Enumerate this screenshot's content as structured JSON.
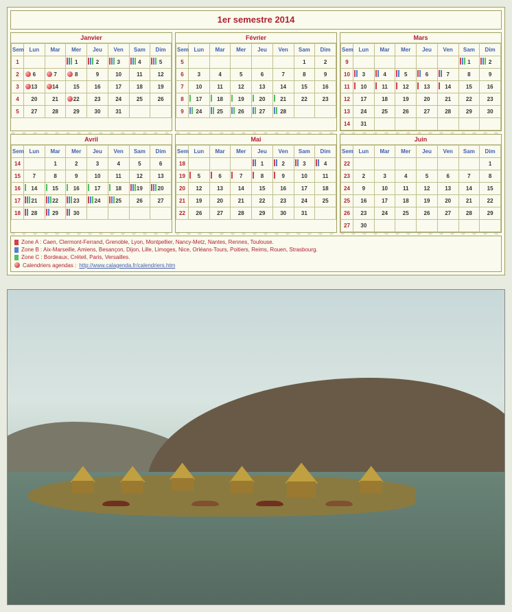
{
  "title": "1er semestre 2014",
  "daysHeader": [
    "Sem",
    "Lun",
    "Mar",
    "Mer",
    "Jeu",
    "Ven",
    "Sam",
    "Dim"
  ],
  "months": [
    {
      "name": "Janvier",
      "weeks": [
        {
          "sem": "1",
          "days": [
            "",
            "",
            "1",
            "2",
            "3",
            "4",
            "5"
          ],
          "marks": {
            "2": [
              "A",
              "B",
              "C"
            ],
            "3": [
              "A",
              "B",
              "C"
            ],
            "4": [
              "A",
              "B",
              "C"
            ],
            "5": [
              "A",
              "B",
              "C"
            ],
            "6": [
              "A",
              "B",
              "C"
            ]
          }
        },
        {
          "sem": "2",
          "days": [
            "6",
            "7",
            "8",
            "9",
            "10",
            "11",
            "12"
          ],
          "marks": {},
          "icons": {
            "0": true,
            "1": true,
            "2": true
          }
        },
        {
          "sem": "3",
          "days": [
            "13",
            "14",
            "15",
            "16",
            "17",
            "18",
            "19"
          ],
          "marks": {},
          "icons": {
            "0": true,
            "1": true
          }
        },
        {
          "sem": "4",
          "days": [
            "20",
            "21",
            "22",
            "23",
            "24",
            "25",
            "26"
          ],
          "marks": {},
          "icons": {
            "2": true
          }
        },
        {
          "sem": "5",
          "days": [
            "27",
            "28",
            "29",
            "30",
            "31",
            "",
            ""
          ],
          "marks": {}
        }
      ]
    },
    {
      "name": "Février",
      "weeks": [
        {
          "sem": "5",
          "days": [
            "",
            "",
            "",
            "",
            "",
            "1",
            "2"
          ],
          "marks": {}
        },
        {
          "sem": "6",
          "days": [
            "3",
            "4",
            "5",
            "6",
            "7",
            "8",
            "9"
          ],
          "marks": {}
        },
        {
          "sem": "7",
          "days": [
            "10",
            "11",
            "12",
            "13",
            "14",
            "15",
            "16"
          ],
          "marks": {}
        },
        {
          "sem": "8",
          "days": [
            "17",
            "18",
            "19",
            "20",
            "21",
            "22",
            "23"
          ],
          "marks": {
            "0": [
              "C"
            ],
            "1": [
              "C"
            ],
            "2": [
              "C"
            ],
            "3": [
              "C"
            ],
            "4": [
              "C"
            ]
          }
        },
        {
          "sem": "9",
          "days": [
            "24",
            "25",
            "26",
            "27",
            "28",
            "",
            ""
          ],
          "marks": {
            "0": [
              "B",
              "C"
            ],
            "1": [
              "B",
              "C"
            ],
            "2": [
              "B",
              "C"
            ],
            "3": [
              "B",
              "C"
            ],
            "4": [
              "B",
              "C"
            ]
          }
        }
      ]
    },
    {
      "name": "Mars",
      "weeks": [
        {
          "sem": "9",
          "days": [
            "",
            "",
            "",
            "",
            "",
            "1",
            "2"
          ],
          "marks": {
            "5": [
              "A",
              "B",
              "C"
            ],
            "6": [
              "A",
              "B",
              "C"
            ]
          }
        },
        {
          "sem": "10",
          "days": [
            "3",
            "4",
            "5",
            "6",
            "7",
            "8",
            "9"
          ],
          "marks": {
            "0": [
              "A",
              "B"
            ],
            "1": [
              "A",
              "B"
            ],
            "2": [
              "A",
              "B"
            ],
            "3": [
              "A",
              "B"
            ],
            "4": [
              "A",
              "B"
            ]
          }
        },
        {
          "sem": "11",
          "days": [
            "10",
            "11",
            "12",
            "13",
            "14",
            "15",
            "16"
          ],
          "marks": {
            "0": [
              "A"
            ],
            "1": [
              "A"
            ],
            "2": [
              "A"
            ],
            "3": [
              "A"
            ],
            "4": [
              "A"
            ]
          }
        },
        {
          "sem": "12",
          "days": [
            "17",
            "18",
            "19",
            "20",
            "21",
            "22",
            "23"
          ],
          "marks": {}
        },
        {
          "sem": "13",
          "days": [
            "24",
            "25",
            "26",
            "27",
            "28",
            "29",
            "30"
          ],
          "marks": {}
        },
        {
          "sem": "14",
          "days": [
            "31",
            "",
            "",
            "",
            "",
            "",
            ""
          ],
          "marks": {}
        }
      ]
    },
    {
      "name": "Avril",
      "weeks": [
        {
          "sem": "14",
          "days": [
            "",
            "1",
            "2",
            "3",
            "4",
            "5",
            "6"
          ],
          "marks": {}
        },
        {
          "sem": "15",
          "days": [
            "7",
            "8",
            "9",
            "10",
            "11",
            "12",
            "13"
          ],
          "marks": {}
        },
        {
          "sem": "16",
          "days": [
            "14",
            "15",
            "16",
            "17",
            "18",
            "19",
            "20"
          ],
          "marks": {
            "0": [
              "C"
            ],
            "1": [
              "C"
            ],
            "2": [
              "C"
            ],
            "3": [
              "C"
            ],
            "4": [
              "C"
            ],
            "5": [
              "A",
              "B",
              "C"
            ],
            "6": [
              "A",
              "B",
              "C"
            ]
          }
        },
        {
          "sem": "17",
          "days": [
            "21",
            "22",
            "23",
            "24",
            "25",
            "26",
            "27"
          ],
          "marks": {
            "0": [
              "A",
              "B",
              "C"
            ],
            "1": [
              "A",
              "B",
              "C"
            ],
            "2": [
              "A",
              "B",
              "C"
            ],
            "3": [
              "A",
              "B",
              "C"
            ],
            "4": [
              "A",
              "B",
              "C"
            ]
          }
        },
        {
          "sem": "18",
          "days": [
            "28",
            "29",
            "30",
            "",
            "",
            "",
            ""
          ],
          "marks": {
            "0": [
              "A",
              "B"
            ],
            "1": [
              "A",
              "B"
            ],
            "2": [
              "A",
              "B"
            ]
          }
        }
      ]
    },
    {
      "name": "Mai",
      "weeks": [
        {
          "sem": "18",
          "days": [
            "",
            "",
            "",
            "1",
            "2",
            "3",
            "4"
          ],
          "marks": {
            "3": [
              "A",
              "B"
            ],
            "4": [
              "A",
              "B"
            ],
            "5": [
              "A",
              "B"
            ],
            "6": [
              "A",
              "B"
            ]
          }
        },
        {
          "sem": "19",
          "days": [
            "5",
            "6",
            "7",
            "8",
            "9",
            "10",
            "11"
          ],
          "marks": {
            "0": [
              "A"
            ],
            "1": [
              "A"
            ],
            "2": [
              "A"
            ],
            "3": [
              "A"
            ],
            "4": [
              "A"
            ]
          }
        },
        {
          "sem": "20",
          "days": [
            "12",
            "13",
            "14",
            "15",
            "16",
            "17",
            "18"
          ],
          "marks": {}
        },
        {
          "sem": "21",
          "days": [
            "19",
            "20",
            "21",
            "22",
            "23",
            "24",
            "25"
          ],
          "marks": {}
        },
        {
          "sem": "22",
          "days": [
            "26",
            "27",
            "28",
            "29",
            "30",
            "31",
            ""
          ],
          "marks": {}
        }
      ]
    },
    {
      "name": "Juin",
      "weeks": [
        {
          "sem": "22",
          "days": [
            "",
            "",
            "",
            "",
            "",
            "",
            "1"
          ],
          "marks": {}
        },
        {
          "sem": "23",
          "days": [
            "2",
            "3",
            "4",
            "5",
            "6",
            "7",
            "8"
          ],
          "marks": {}
        },
        {
          "sem": "24",
          "days": [
            "9",
            "10",
            "11",
            "12",
            "13",
            "14",
            "15"
          ],
          "marks": {}
        },
        {
          "sem": "25",
          "days": [
            "16",
            "17",
            "18",
            "19",
            "20",
            "21",
            "22"
          ],
          "marks": {}
        },
        {
          "sem": "26",
          "days": [
            "23",
            "24",
            "25",
            "26",
            "27",
            "28",
            "29"
          ],
          "marks": {}
        },
        {
          "sem": "27",
          "days": [
            "30",
            "",
            "",
            "",
            "",
            "",
            ""
          ],
          "marks": {}
        }
      ]
    }
  ],
  "legend": {
    "zoneA": "Zone A : Caen, Clermont-Ferrand, Grenoble, Lyon, Montpellier, Nancy-Metz, Nantes, Rennes, Toulouse.",
    "zoneB": "Zone B : Aix-Marseille, Amiens, Besançon, Dijon, Lille, Limoges, Nice, Orléans-Tours, Poitiers, Reims, Rouen, Strasbourg.",
    "zoneC": "Zone C : Bordeaux, Créteil, Paris, Versailles.",
    "linkLabel": "Calendriers agendas : ",
    "linkUrl": "http://www.calagenda.fr/calendriers.htm"
  }
}
